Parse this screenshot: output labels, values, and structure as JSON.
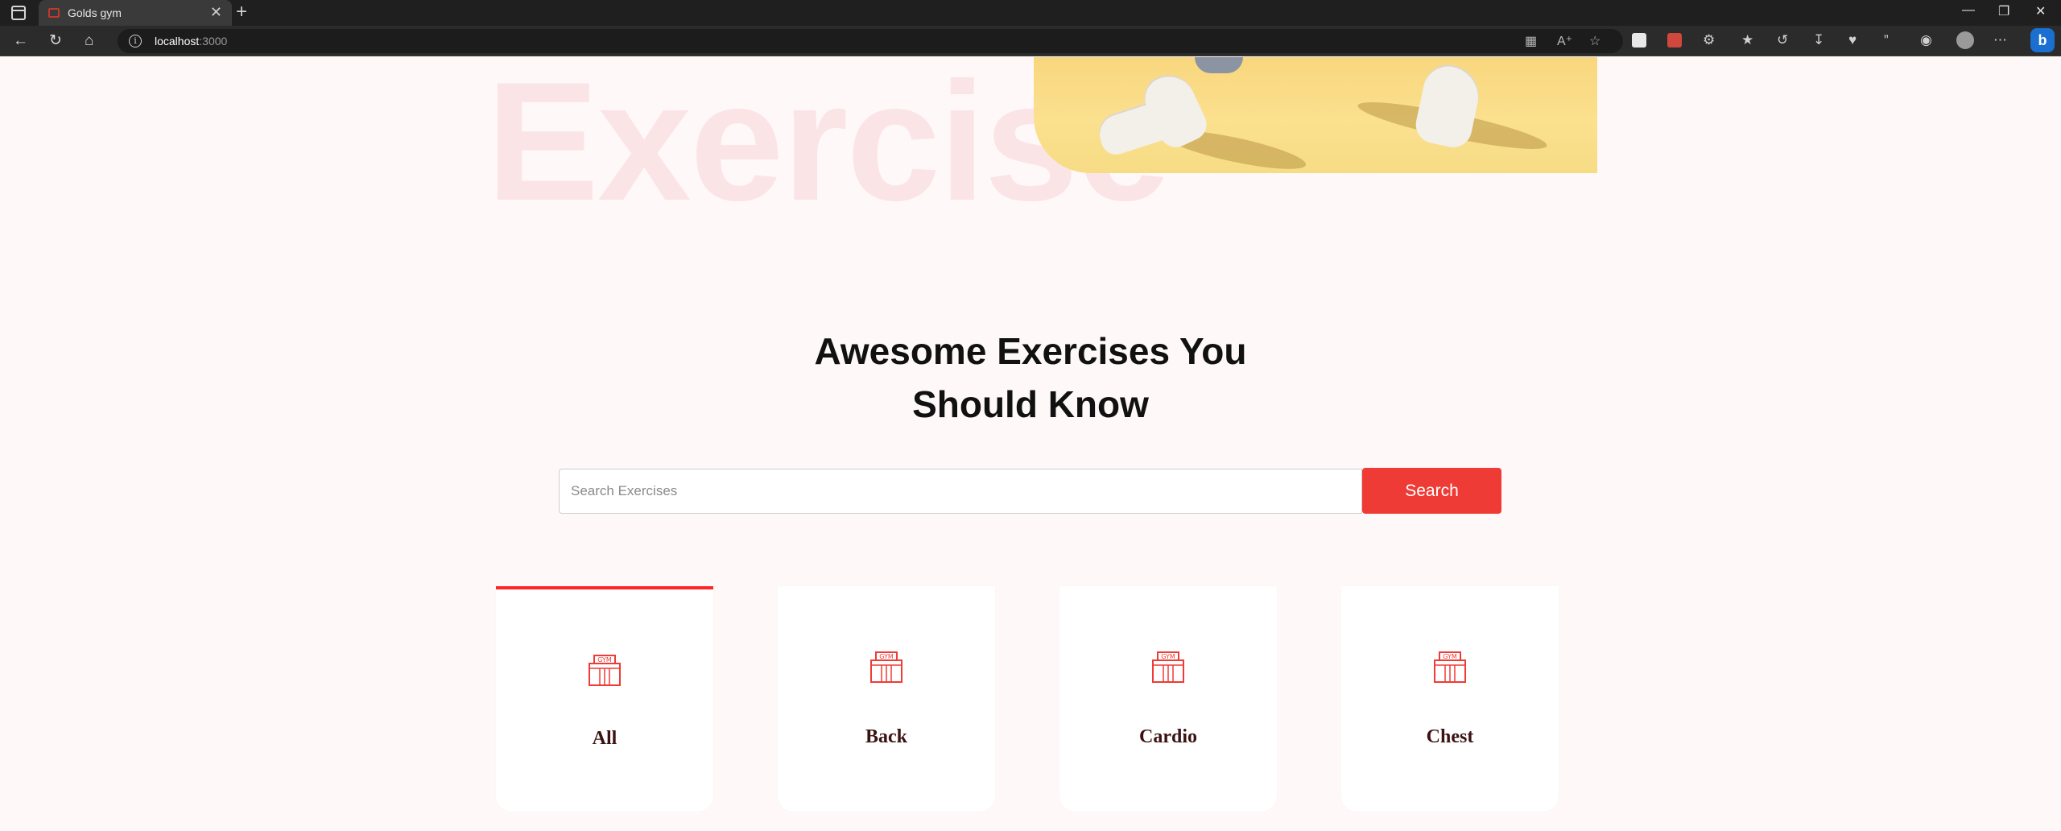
{
  "browser": {
    "tab_title": "Golds gym",
    "tab_close": "✕",
    "new_tab": "+",
    "url_host": "localhost",
    "url_port": ":3000",
    "window_controls": [
      "—",
      "❐",
      "✕"
    ]
  },
  "hero": {
    "background_word": "Exercise"
  },
  "section": {
    "heading_line1": "Awesome Exercises You",
    "heading_line2": "Should Know"
  },
  "search": {
    "placeholder": "Search Exercises",
    "value": "",
    "button_label": "Search"
  },
  "categories": [
    {
      "label": "All",
      "selected": true,
      "icon": "gym-icon"
    },
    {
      "label": "Back",
      "selected": false,
      "icon": "gym-icon"
    },
    {
      "label": "Cardio",
      "selected": false,
      "icon": "gym-icon"
    },
    {
      "label": "Chest",
      "selected": false,
      "icon": "gym-icon"
    }
  ],
  "colors": {
    "accent": "#ef3b36",
    "active_border": "#ff2625",
    "page_bg": "#fff8f9",
    "hero_word": "#fbe4e6"
  }
}
